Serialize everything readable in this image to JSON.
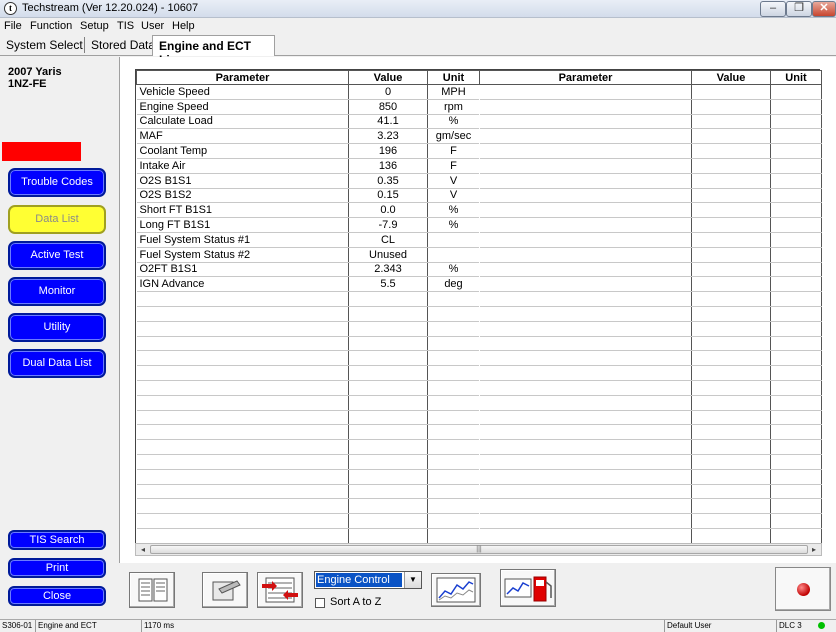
{
  "window": {
    "title": "Techstream (Ver 12.20.024) - 10607",
    "min_label": "–",
    "max_label": "❐",
    "close_label": "✕"
  },
  "menu": [
    "File",
    "Function",
    "Setup",
    "TIS",
    "User",
    "Help"
  ],
  "tabs": {
    "system_select": "System Select",
    "stored_data": "Stored Data",
    "active": "Engine and ECT Live"
  },
  "vehicle": {
    "model": "2007 Yaris",
    "engine": "1NZ-FE"
  },
  "sidebar": {
    "buttons": [
      "Trouble Codes",
      "Data List",
      "Active Test",
      "Monitor",
      "Utility",
      "Dual Data List"
    ],
    "active_button": "Data List",
    "bottom_buttons": [
      "TIS Search",
      "Print",
      "Close"
    ]
  },
  "table": {
    "headers": {
      "parameter": "Parameter",
      "value": "Value",
      "unit": "Unit"
    },
    "rows": [
      {
        "parameter": "Vehicle Speed",
        "value": "0",
        "unit": "MPH"
      },
      {
        "parameter": "Engine Speed",
        "value": "850",
        "unit": "rpm"
      },
      {
        "parameter": "Calculate Load",
        "value": "41.1",
        "unit": "%"
      },
      {
        "parameter": "MAF",
        "value": "3.23",
        "unit": "gm/sec"
      },
      {
        "parameter": "Coolant Temp",
        "value": "196",
        "unit": "F"
      },
      {
        "parameter": "Intake Air",
        "value": "136",
        "unit": "F"
      },
      {
        "parameter": "O2S B1S1",
        "value": "0.35",
        "unit": "V"
      },
      {
        "parameter": "O2S B1S2",
        "value": "0.15",
        "unit": "V"
      },
      {
        "parameter": "Short FT B1S1",
        "value": "0.0",
        "unit": "%"
      },
      {
        "parameter": "Long FT B1S1",
        "value": "-7.9",
        "unit": "%"
      },
      {
        "parameter": "Fuel System Status #1",
        "value": "CL",
        "unit": ""
      },
      {
        "parameter": "Fuel System Status #2",
        "value": "Unused",
        "unit": ""
      },
      {
        "parameter": "O2FT B1S1",
        "value": "2.343",
        "unit": "%"
      },
      {
        "parameter": "IGN Advance",
        "value": "5.5",
        "unit": "deg"
      }
    ]
  },
  "scrollbar": {
    "left_arrow": "◂",
    "right_arrow": "▸",
    "grip": "|||"
  },
  "toolbar": {
    "select_value": "Engine Control",
    "select_arrow": "▼",
    "sort_label": "Sort A to Z"
  },
  "status": {
    "code": "S306-01",
    "system": "Engine and ECT",
    "time": "1170 ms",
    "user": "Default User",
    "port": "DLC 3",
    "connected_color": "#00c000"
  }
}
